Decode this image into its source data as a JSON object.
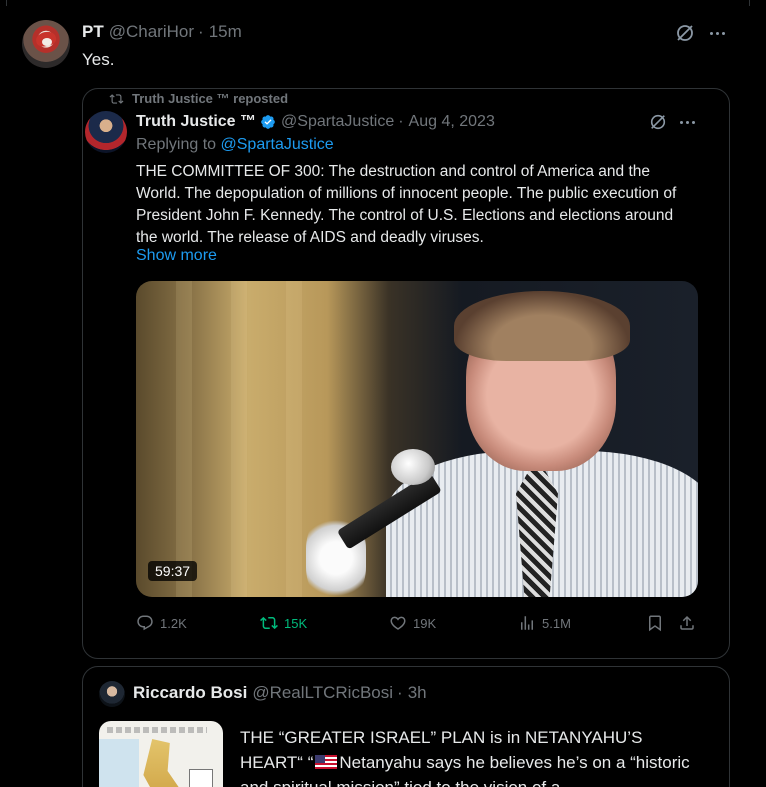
{
  "post": {
    "name": "PT",
    "handle": "@ChariHor",
    "separator": "·",
    "time": "15m",
    "text": "Yes."
  },
  "quoted_post": {
    "repost_label": "Truth Justice ™ reposted",
    "name": "Truth Justice ™",
    "handle": "@SpartaJustice",
    "separator": "·",
    "date": "Aug 4, 2023",
    "replying_prefix": "Replying to",
    "replying_handle": "@SpartaJustice",
    "body": "THE COMMITTEE OF 300: The destruction and control of America and the World. The depopulation of millions of innocent people. The public execution of President John F. Kennedy. The control of U.S. Elections and elections around the world. The release of AIDS and deadly viruses.",
    "show_more": "Show more",
    "video_duration": "59:37",
    "actions": {
      "replies": "1.2K",
      "reposts": "15K",
      "likes": "19K",
      "views": "5.1M"
    }
  },
  "quoted_post_2": {
    "name": "Riccardo Bosi",
    "handle": "@RealLTCRicBosi",
    "separator": "·",
    "time": "3h",
    "text_part1": "THE “GREATER ISRAEL” PLAN is in NETANYAHU’S HEART“  “",
    "text_part2": "Netanyahu says he believes he’s on a “historic and spiritual mission” tied to the vision of a"
  },
  "colors": {
    "background": "#000000",
    "text": "#e7e9ea",
    "muted": "#71767b",
    "link": "#1d9bf0",
    "repost_active": "#00ba7c",
    "border": "#2f3336"
  },
  "icons": {
    "grok": "grok-icon",
    "more": "more-icon",
    "repost": "repost-icon",
    "verified": "verified-badge-icon",
    "reply": "reply-icon",
    "like": "heart-icon",
    "views": "views-icon",
    "bookmark": "bookmark-icon",
    "share": "share-icon",
    "flag": "us-flag-icon"
  }
}
